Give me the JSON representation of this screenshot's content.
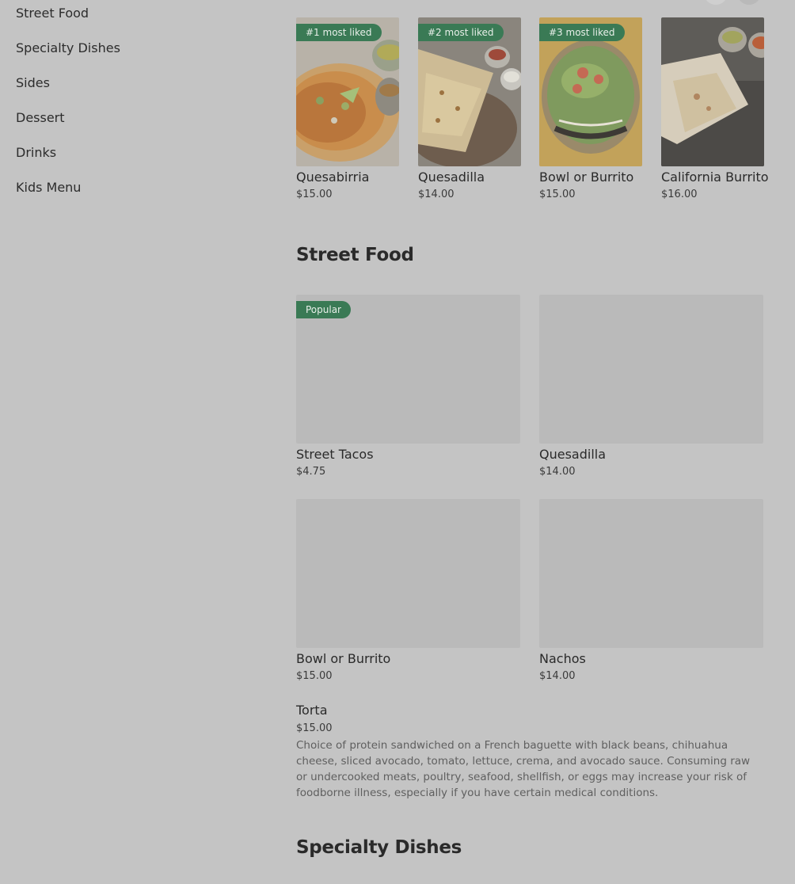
{
  "sidebar": {
    "items": [
      {
        "label": "Street Food"
      },
      {
        "label": "Specialty Dishes"
      },
      {
        "label": "Sides"
      },
      {
        "label": "Dessert"
      },
      {
        "label": "Drinks"
      },
      {
        "label": "Kids Menu"
      }
    ]
  },
  "featured": [
    {
      "badge": "#1 most liked",
      "name": "Quesabirria",
      "price": "$15.00"
    },
    {
      "badge": "#2 most liked",
      "name": "Quesadilla",
      "price": "$14.00"
    },
    {
      "badge": "#3 most liked",
      "name": "Bowl or Burrito",
      "price": "$15.00"
    },
    {
      "badge": "",
      "name": "California Burrito",
      "price": "$16.00"
    }
  ],
  "street_food": {
    "title": "Street Food",
    "items": [
      {
        "badge": "Popular",
        "name": "Street Tacos",
        "price": "$4.75"
      },
      {
        "badge": "",
        "name": "Quesadilla",
        "price": "$14.00"
      },
      {
        "badge": "",
        "name": "Bowl or Burrito",
        "price": "$15.00"
      },
      {
        "badge": "",
        "name": "Nachos",
        "price": "$14.00"
      }
    ],
    "text_item": {
      "name": "Torta",
      "price": "$15.00",
      "description": "Choice of protein sandwiched on a French baguette with black beans, chihuahua cheese, sliced avocado, tomato, lettuce, crema, and avocado sauce. Consuming raw or undercooked meats, poultry, seafood, shellfish, or eggs may increase your risk of foodborne illness, especially if you have certain medical conditions."
    }
  },
  "specialty_dishes": {
    "title": "Specialty Dishes"
  },
  "colors": {
    "badge_bg": "#3a7a55",
    "overlay_bg": "#c4c4c4"
  }
}
